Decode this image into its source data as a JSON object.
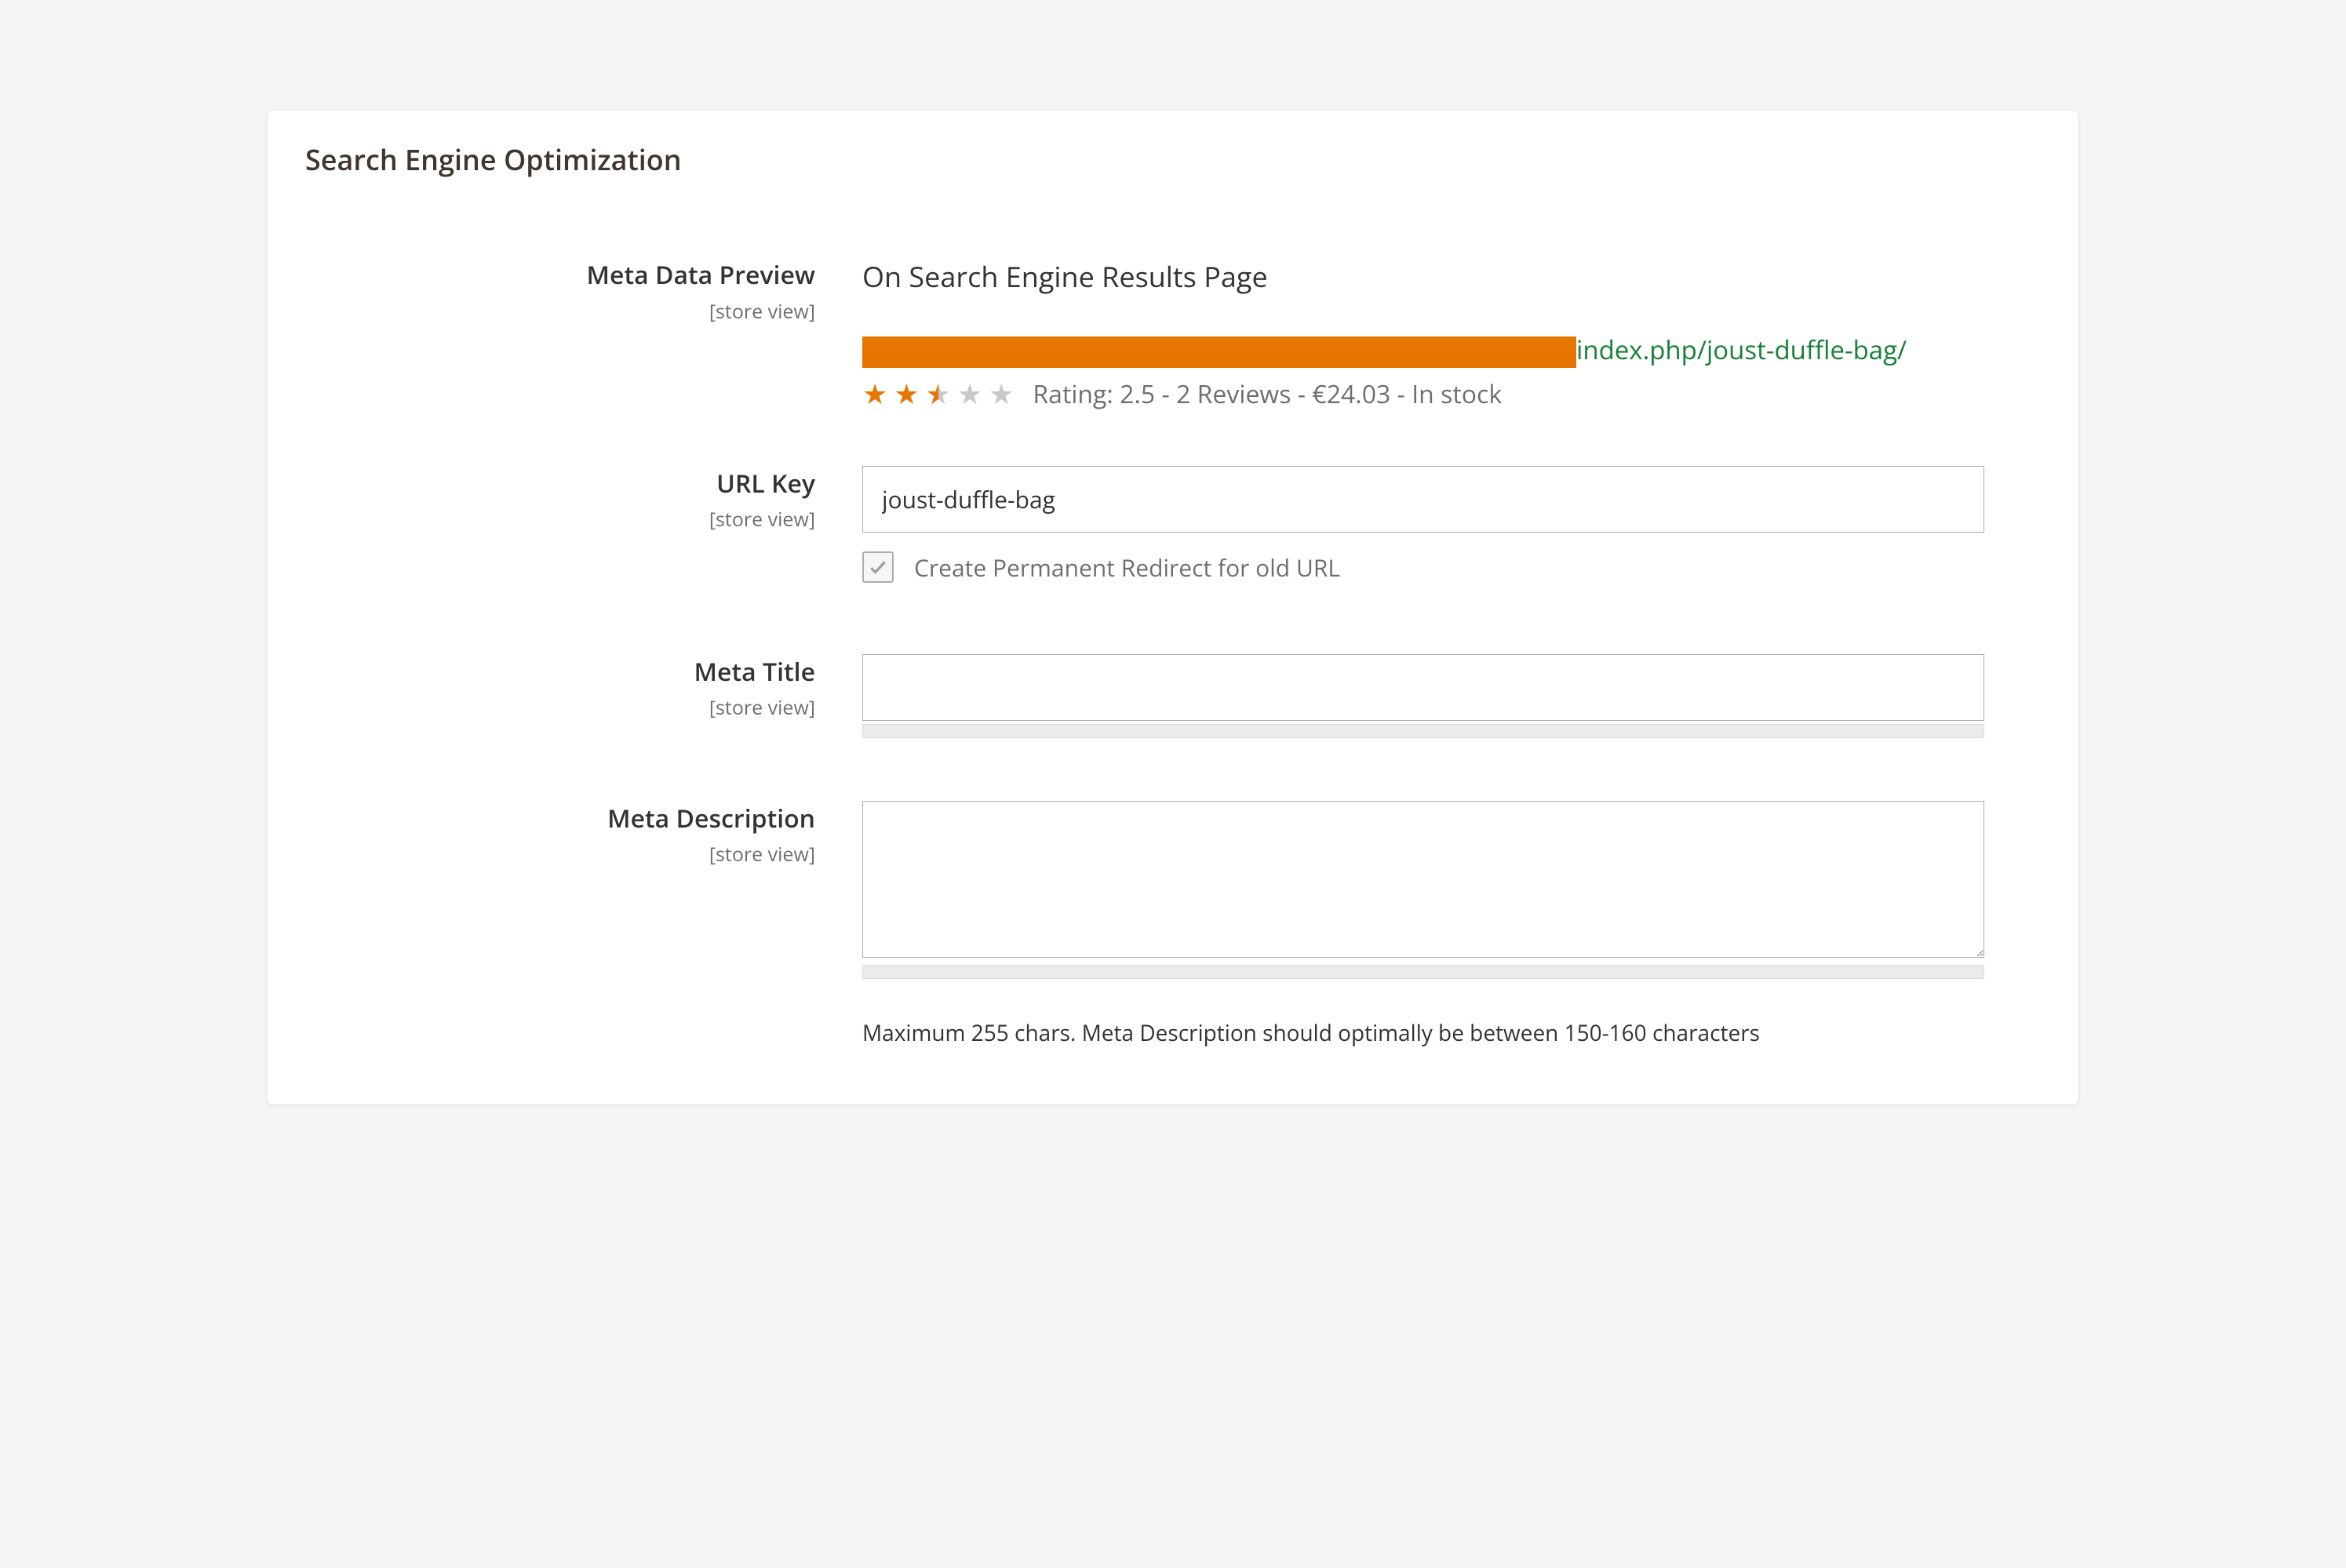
{
  "panel": {
    "title": "Search Engine Optimization",
    "scope_label": "[store view]"
  },
  "preview": {
    "label": "Meta Data Preview",
    "heading": "On Search Engine Results Page",
    "url_visible": "index.php/joust-duffle-bag/",
    "rating_stars": 2.5,
    "rating_text": "Rating: 2.5 - 2 Reviews - €24.03 - In stock"
  },
  "url_key": {
    "label": "URL Key",
    "value": "joust-duffle-bag",
    "redirect_checkbox_label": "Create Permanent Redirect for old URL",
    "redirect_checked": true,
    "redirect_disabled": true
  },
  "meta_title": {
    "label": "Meta Title",
    "value": ""
  },
  "meta_description": {
    "label": "Meta Description",
    "value": "",
    "hint": "Maximum 255 chars. Meta Description should optimally be between 150-160 characters"
  }
}
